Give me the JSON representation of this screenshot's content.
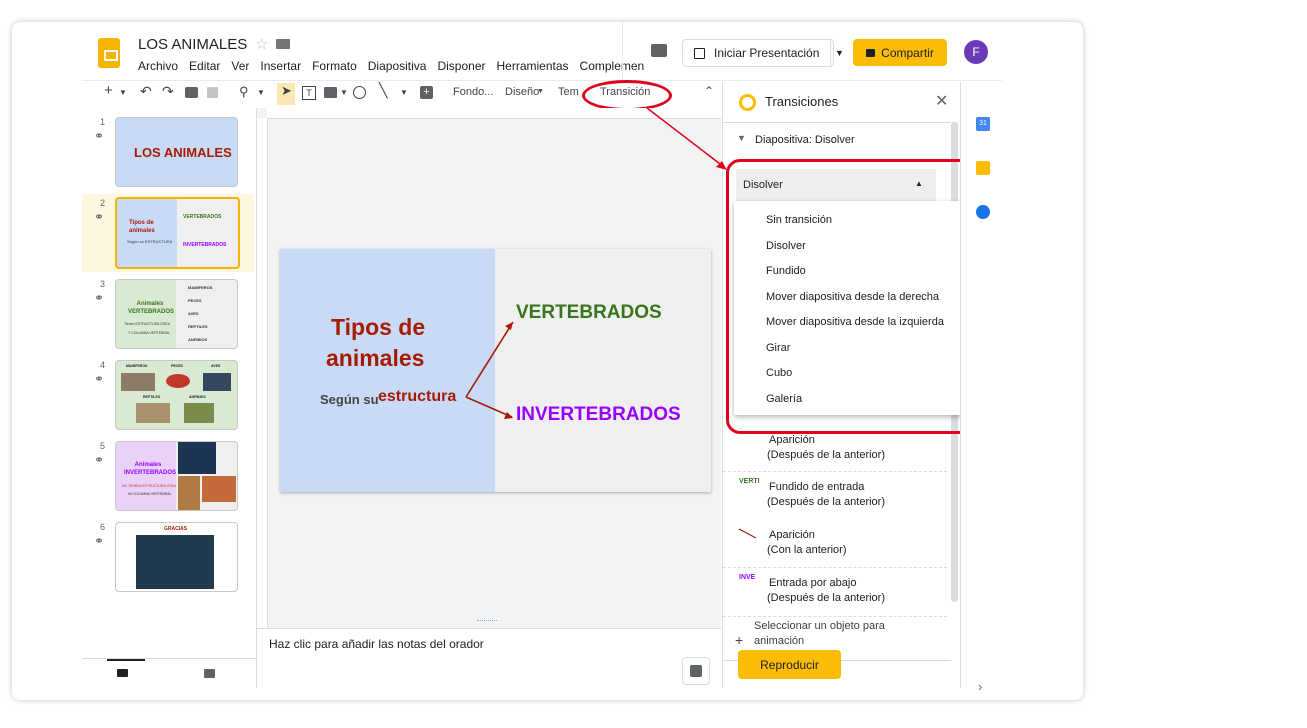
{
  "document": {
    "title": "LOS ANIMALES",
    "menu": [
      "Archivo",
      "Editar",
      "Ver",
      "Insertar",
      "Formato",
      "Diapositiva",
      "Disponer",
      "Herramientas",
      "Complemen"
    ]
  },
  "header": {
    "present_label": "Iniciar Presentación",
    "share_label": "Compartir",
    "avatar_initial": "F"
  },
  "toolbar": {
    "fondo": "Fondo...",
    "diseno": "Diseño",
    "tema": "Tem",
    "transicion": "Transición"
  },
  "thumbnails": [
    {
      "num": "1",
      "title": "LOS ANIMALES"
    },
    {
      "num": "2",
      "title": "Tipos de animales",
      "sub": "Según su ESTRUCTURA",
      "right1": "VERTEBRADOS",
      "right2": "INVERTEBRADOS"
    },
    {
      "num": "3",
      "title": "Animales VERTEBRADOS",
      "sub1": "Tienen ESTRUCTURA ÓSEA",
      "sub2": "Y COLUMNA VERTEBRAL",
      "list": [
        "MAMÍFEROS",
        "PECES",
        "AVES",
        "REPTILES",
        "ANFIBIOS"
      ]
    },
    {
      "num": "4",
      "labels": [
        "MAMÍFEROS",
        "PECES",
        "AVES",
        "REPTILES",
        "ANFIBIOS"
      ]
    },
    {
      "num": "5",
      "title": "Animales INVERTEBRADOS",
      "sub1": "NO TIENEN ESTRUCTURA ÓSEA",
      "sub2": "NI COLUMNA VERTEBRAL"
    },
    {
      "num": "6",
      "title": "GRACIAS"
    }
  ],
  "slide": {
    "title_line1": "Tipos de",
    "title_line2": "animales",
    "sub_prefix": "Según su",
    "sub_emph": "estructura",
    "right1": "VERTEBRADOS",
    "right2": "INVERTEBRADOS"
  },
  "notes": {
    "placeholder": "Haz clic para añadir las notas del orador"
  },
  "panel": {
    "title": "Transiciones",
    "section": "Diapositiva: Disolver",
    "selected": "Disolver",
    "options": [
      "Sin transición",
      "Disolver",
      "Fundido",
      "Mover diapositiva desde la derecha",
      "Mover diapositiva desde la izquierda",
      "Girar",
      "Cubo",
      "Galería"
    ],
    "animations": [
      {
        "thumb": "",
        "name": "Aparición",
        "when": "(Después de la anterior)"
      },
      {
        "thumb": "VERTI",
        "name": "Fundido de entrada",
        "when": "(Después de la anterior)"
      },
      {
        "thumb": "",
        "name": "Aparición",
        "when": "(Con la anterior)"
      },
      {
        "thumb": "INVE",
        "name": "Entrada por abajo",
        "when": "(Después de la anterior)"
      }
    ],
    "select_hint_1": "Seleccionar un objeto para",
    "select_hint_2": "animación",
    "play_label": "Reproducir"
  },
  "colors": {
    "accent": "#fbbc04",
    "highlight_red": "#e0001b",
    "slide_left": "#c9daf8",
    "title_red": "#a61c00",
    "green": "#38761d",
    "purple": "#9900ff"
  }
}
